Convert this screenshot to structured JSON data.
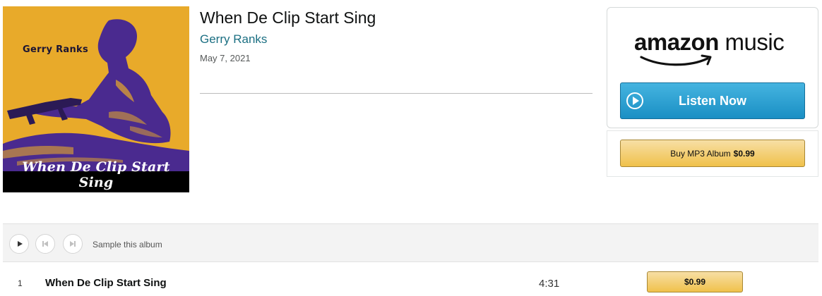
{
  "album": {
    "title": "When De Clip Start Sing",
    "artist": "Gerry Ranks",
    "release_date": "May 7, 2021",
    "cover": {
      "artist_text": "Gerry Ranks",
      "title_text": "When De Clip Start Sing",
      "background_color": "#e8aa2a",
      "figure_color": "#4a2a8f"
    }
  },
  "buybox": {
    "logo_brand": "amazon",
    "logo_product": "music",
    "listen_label": "Listen Now",
    "listen_color": "#2a9fd6",
    "mp3_label": "Buy MP3 Album",
    "mp3_price": "$0.99"
  },
  "sampler": {
    "label": "Sample this album"
  },
  "tracks": [
    {
      "number": "1",
      "title": "When De Clip Start Sing",
      "duration": "4:31",
      "price": "$0.99"
    }
  ]
}
